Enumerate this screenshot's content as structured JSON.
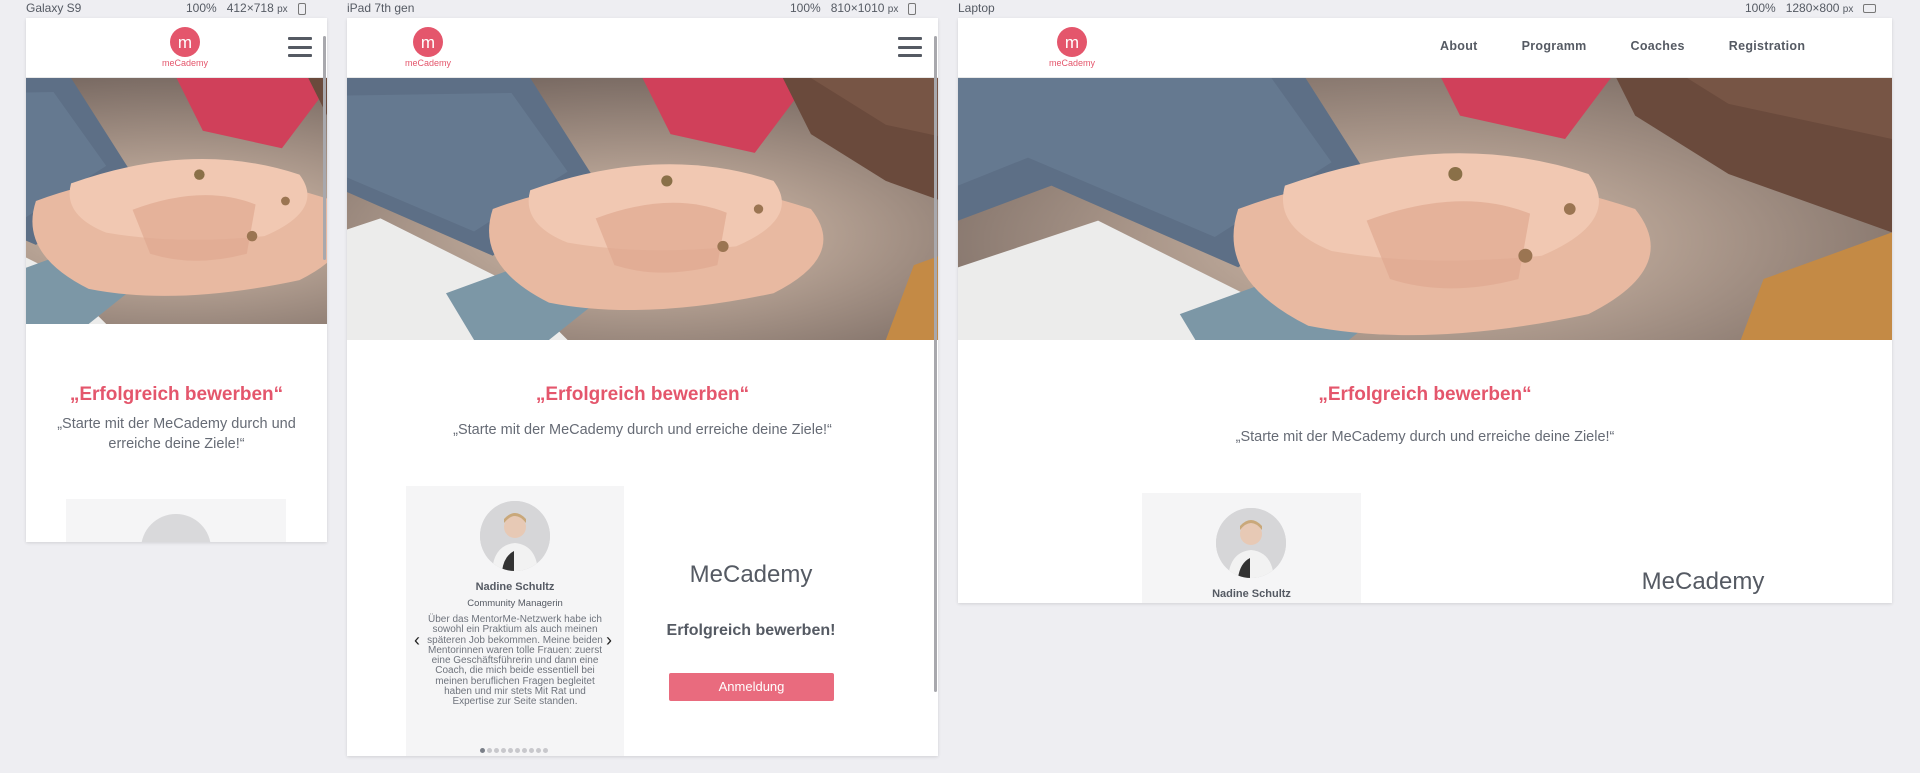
{
  "devices": [
    {
      "name": "Galaxy S9",
      "zoom": "100%",
      "width": "412",
      "sep": "×",
      "height": "718",
      "unit": "px"
    },
    {
      "name": "iPad 7th gen",
      "zoom": "100%",
      "width": "810",
      "sep": "×",
      "height": "1010",
      "unit": "px"
    },
    {
      "name": "Laptop",
      "zoom": "100%",
      "width": "1280",
      "sep": "×",
      "height": "800",
      "unit": "px"
    }
  ],
  "site": {
    "logo_letter": "m",
    "logo_text": "meCademy",
    "nav": [
      "About",
      "Programm",
      "Coaches",
      "Registration"
    ],
    "headline": "„Erfolgreich bewerben“",
    "subline": "„Starte mit der MeCademy durch und erreiche deine Ziele!“",
    "testimonial": {
      "name": "Nadine Schultz",
      "role": "Community Managerin",
      "quote": "Über das MentorMe-Netzwerk habe ich sowohl ein Praktium als auch meinen späteren Job bekommen. Meine beiden Mentorinnen waren tolle Frauen: zuerst eine Geschäftsführerin und dann eine Coach, die mich beide essentiell bei meinen beruflichen Fragen begleitet haben und mir stets Mit Rat und Expertise zur Seite standen.",
      "prev": "‹",
      "next": "›",
      "slides": 10,
      "active": 1
    },
    "brand_title": "MeCademy",
    "cta_text": "Erfolgreich bewerben!",
    "cta_button": "Anmeldung"
  },
  "colors": {
    "accent": "#e4566c",
    "button": "#e96b7e",
    "text": "#555a63",
    "page_bg": "#eeeef2"
  }
}
